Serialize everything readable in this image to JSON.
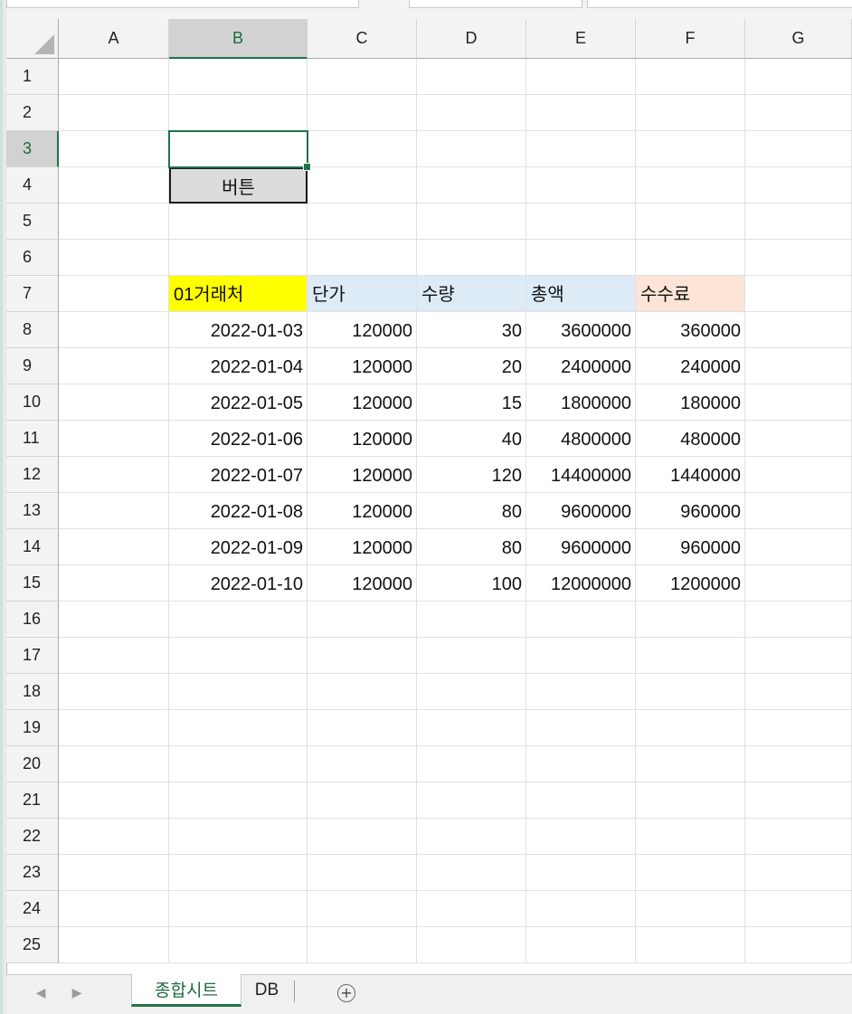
{
  "columns": [
    "A",
    "B",
    "C",
    "D",
    "E",
    "F",
    "G"
  ],
  "selected_column": "B",
  "rows": [
    "1",
    "2",
    "3",
    "4",
    "5",
    "6",
    "7",
    "8",
    "9",
    "10",
    "11",
    "12",
    "13",
    "14",
    "15",
    "16",
    "17",
    "18",
    "19",
    "20",
    "21",
    "22",
    "23",
    "24",
    "25"
  ],
  "selected_row": "3",
  "active_cell": "B3",
  "button": {
    "label": "버튼",
    "cell": "B4"
  },
  "table": {
    "headers": [
      {
        "text": "01거래처",
        "fill": "#FFFF00"
      },
      {
        "text": "단가",
        "fill": "#DDEBF7"
      },
      {
        "text": "수량",
        "fill": "#DDEBF7"
      },
      {
        "text": "총액",
        "fill": "#DDEBF7"
      },
      {
        "text": "수수료",
        "fill": "#FCE4D6"
      }
    ],
    "rows": [
      [
        "2022-01-03",
        "120000",
        "30",
        "3600000",
        "360000"
      ],
      [
        "2022-01-04",
        "120000",
        "20",
        "2400000",
        "240000"
      ],
      [
        "2022-01-05",
        "120000",
        "15",
        "1800000",
        "180000"
      ],
      [
        "2022-01-06",
        "120000",
        "40",
        "4800000",
        "480000"
      ],
      [
        "2022-01-07",
        "120000",
        "120",
        "14400000",
        "1440000"
      ],
      [
        "2022-01-08",
        "120000",
        "80",
        "9600000",
        "960000"
      ],
      [
        "2022-01-09",
        "120000",
        "80",
        "9600000",
        "960000"
      ],
      [
        "2022-01-10",
        "120000",
        "100",
        "12000000",
        "1200000"
      ]
    ]
  },
  "sheet_tabs": [
    {
      "label": "종합시트",
      "active": true
    },
    {
      "label": "DB",
      "active": false
    }
  ],
  "add_sheet_symbol": "+",
  "nav_icons": [
    "previous-sheet-icon",
    "next-sheet-icon"
  ],
  "colors": {
    "accent": "#217346",
    "header_bg": "#F3F3F3",
    "selected_header_bg": "#D2D2D2",
    "gridline": "#E1E1E1"
  }
}
